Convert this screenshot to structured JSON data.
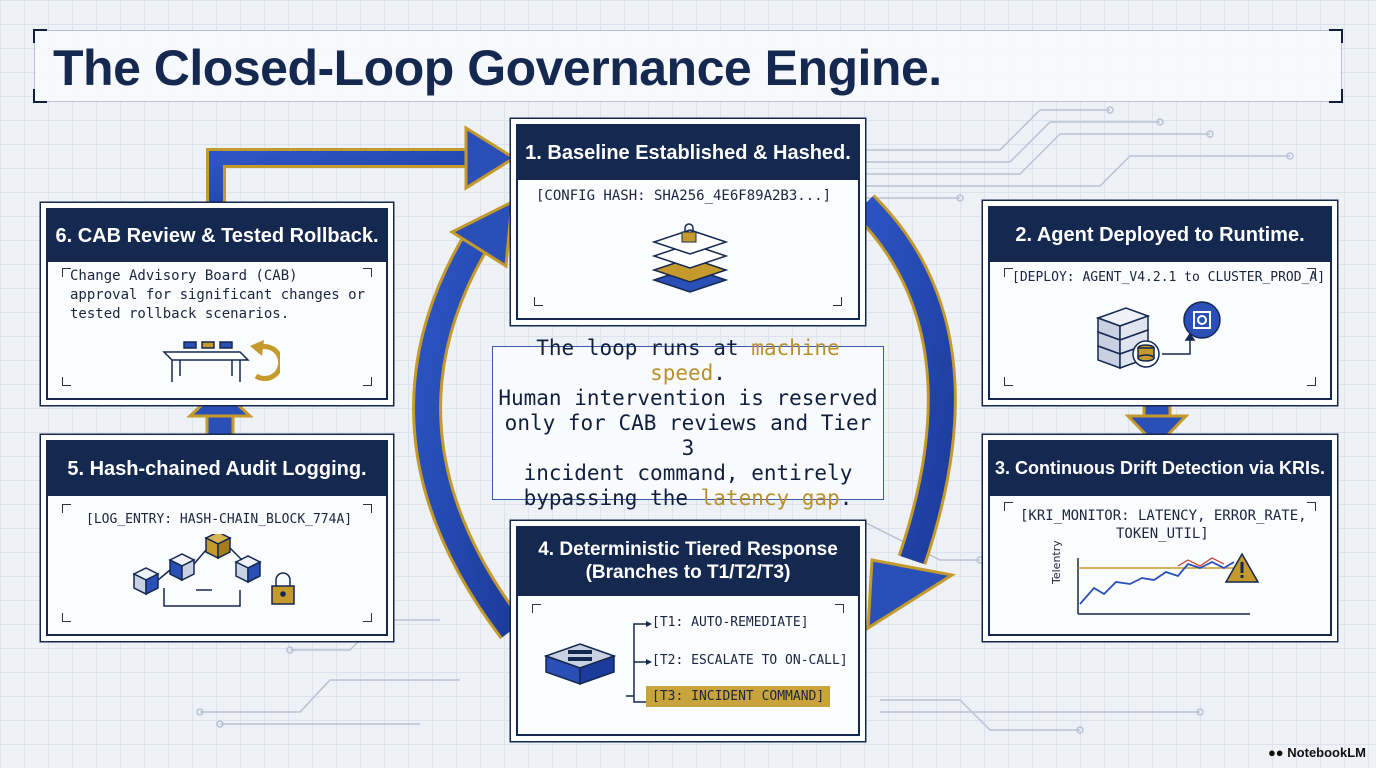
{
  "title": "The Closed-Loop Governance Engine.",
  "steps": [
    {
      "heading": "1. Baseline Established & Hashed.",
      "code": "[CONFIG HASH: SHA256_4E6F89A2B3...]"
    },
    {
      "heading": "2. Agent Deployed to Runtime.",
      "code": "[DEPLOY: AGENT_V4.2.1 to CLUSTER_PROD_A]"
    },
    {
      "heading": "3. Continuous Drift Detection via KRIs.",
      "code_line1": "[KRI_MONITOR: LATENCY, ERROR_RATE,",
      "code_line2": "TOKEN_UTIL]",
      "chart_axis_label": "Telentry"
    },
    {
      "heading_line1": "4. Deterministic Tiered Response",
      "heading_line2": "(Branches to T1/T2/T3)",
      "branches": [
        "[T1: AUTO-REMEDIATE]",
        "[T2: ESCALATE TO ON-CALL]",
        "[T3: INCIDENT COMMAND]"
      ]
    },
    {
      "heading": "5. Hash-chained Audit Logging.",
      "code": "[LOG_ENTRY: HASH-CHAIN_BLOCK_774A]"
    },
    {
      "heading": "6. CAB Review & Tested Rollback.",
      "lines": [
        "Change Advisory Board (CAB)",
        "approval for significant changes or",
        "tested rollback scenarios."
      ]
    }
  ],
  "center": {
    "line1_a": "The loop runs at ",
    "line1_hl": "machine speed",
    "line1_b": ".",
    "line2": "Human intervention is reserved",
    "line3": "only for CAB reviews and Tier 3",
    "line4": "incident command, entirely",
    "line5_a": "bypassing the ",
    "line5_hl": "latency gap",
    "line5_b": "."
  },
  "icons": {
    "step1": "locked-stacked-layers-icon",
    "step2": "server-database-icon",
    "step3": "warning-icon",
    "step4": "server-icon",
    "step5": "hash-chain-blocks-icon",
    "step6": "rollback-table-icon"
  },
  "brand": "NotebookLM",
  "colors": {
    "navy": "#142850",
    "blue": "#2a4fb6",
    "gold": "#c49a2c"
  }
}
